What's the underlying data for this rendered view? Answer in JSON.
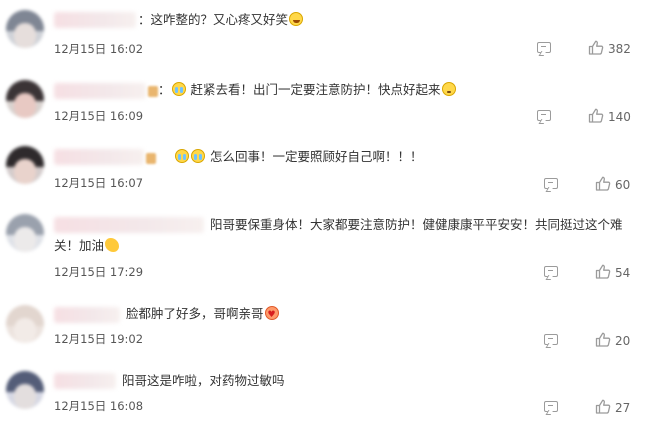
{
  "comments": [
    {
      "text": [
        "：这咋整的？又心疼又好笑"
      ],
      "emojis": [
        "laugh-cry-emoji"
      ],
      "time": "12月15日 16:02",
      "likes": "382"
    },
    {
      "text": [
        "：",
        "赶紧去看！出门一定要注意防护！快点好起来"
      ],
      "emojis": [
        "cry-emoji",
        "sweat-emoji"
      ],
      "time": "12月15日 16:09",
      "likes": "140"
    },
    {
      "text": [
        "怎么回事！一定要照顾好自己啊！！！"
      ],
      "emojis": [
        "cry-emoji",
        "cry-emoji"
      ],
      "time": "12月15日 16:07",
      "likes": "60"
    },
    {
      "text": [
        "阳哥要保重身体！大家都要注意防护！健健康康平平安安！共同挺过这个难",
        "关！加油"
      ],
      "emojis": [
        "flex-emoji"
      ],
      "time": "12月15日 17:29",
      "likes": "54"
    },
    {
      "text": [
        "脸都肿了好多，哥啊亲哥"
      ],
      "emojis": [
        "heart-face-emoji"
      ],
      "time": "12月15日 19:02",
      "likes": "20"
    },
    {
      "text": [
        "阳哥这是咋啦，对药物过敏吗"
      ],
      "emojis": [],
      "time": "12月15日 16:08",
      "likes": "27"
    }
  ],
  "colors": {
    "text": "#333333",
    "time": "#555555",
    "icon": "#9b9b9b",
    "name_blur": "#f3e8ea"
  },
  "icons": {
    "comment": "comment-icon",
    "like": "thumbs-up-icon"
  }
}
